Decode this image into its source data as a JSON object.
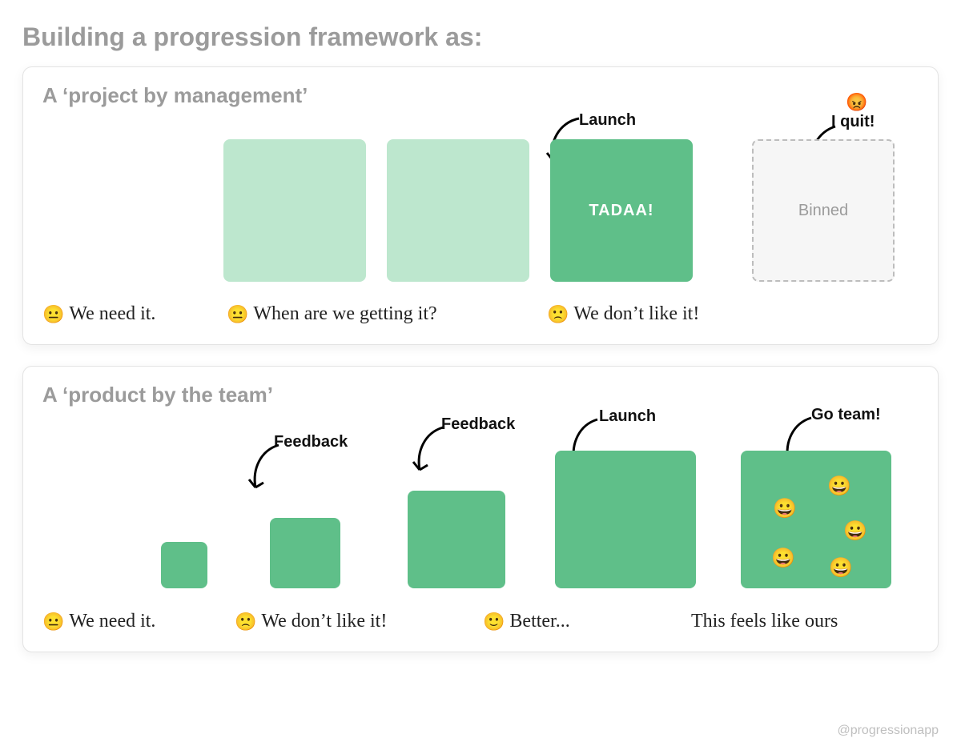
{
  "title": "Building a progression framework as:",
  "credit": "@progressionapp",
  "panel1": {
    "title": "A ‘project by management’",
    "annot_launch": "Launch",
    "annot_quit_emoji": "😡",
    "annot_quit": "I quit!",
    "box_tadaa": "TADAA!",
    "box_binned": "Binned",
    "captions": [
      {
        "emoji": "😐",
        "text": "We need it."
      },
      {
        "emoji": "😐",
        "text": "When are we getting it?"
      },
      {
        "emoji": "🙁",
        "text": "We don’t like it!"
      }
    ]
  },
  "panel2": {
    "title": "A ‘product by the team’",
    "annot_feedback1": "Feedback",
    "annot_feedback2": "Feedback",
    "annot_launch": "Launch",
    "annot_goteam": "Go team!",
    "smileys": [
      "😀",
      "😀",
      "😀",
      "😀",
      "😀"
    ],
    "captions": [
      {
        "emoji": "😐",
        "text": "We need it."
      },
      {
        "emoji": "🙁",
        "text": "We don’t like it!"
      },
      {
        "emoji": "🙂",
        "text": "Better..."
      },
      {
        "emoji": "",
        "text": "This feels like ours"
      }
    ]
  }
}
